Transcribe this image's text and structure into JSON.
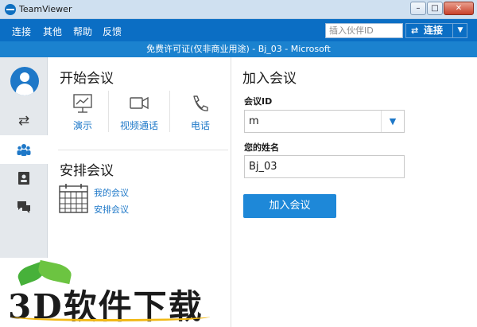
{
  "window": {
    "title": "TeamViewer",
    "min_label": "–",
    "max_label": "□",
    "close_label": "✕"
  },
  "menu": {
    "items": [
      "连接",
      "其他",
      "帮助",
      "反馈"
    ],
    "partner_id_placeholder": "插入伙伴ID",
    "connect_label": "连接"
  },
  "license_text": "免费许可证(仅非商业用途) - Bj_03 - Microsoft",
  "start_meeting": {
    "title": "开始会议",
    "actions": [
      {
        "label": "演示",
        "icon": "presentation-icon"
      },
      {
        "label": "视频通话",
        "icon": "video-camera-icon"
      },
      {
        "label": "电话",
        "icon": "phone-icon"
      }
    ]
  },
  "schedule_meeting": {
    "title": "安排会议",
    "links": [
      "我的会议",
      "安排会议"
    ]
  },
  "join_meeting": {
    "title": "加入会议",
    "meeting_id_label": "会议ID",
    "meeting_id_value": "m",
    "name_label": "您的姓名",
    "name_value": "Bj_03",
    "join_button": "加入会议"
  },
  "watermark": {
    "text": "3D软件下载"
  },
  "colors": {
    "menu_bar": "#0b6ec4",
    "license_strip": "#1b82cf",
    "accent": "#1e88d8",
    "nav_bg": "#e4e8ec"
  }
}
